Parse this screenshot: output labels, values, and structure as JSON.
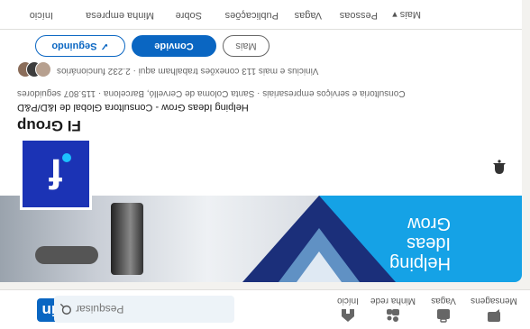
{
  "global_nav": {
    "logo": "in",
    "search_placeholder": "Pesquisar",
    "items": [
      {
        "label": "Início",
        "icon": "home-icon"
      },
      {
        "label": "Minha rede",
        "icon": "network-icon"
      },
      {
        "label": "Vagas",
        "icon": "briefcase-icon"
      },
      {
        "label": "Mensagens",
        "icon": "messaging-icon"
      }
    ]
  },
  "company": {
    "banner_tagline": [
      "Helping",
      "Ideas",
      "Grow"
    ],
    "logo_text": "f",
    "name": "FI Group",
    "tagline": "Helping Ideas Grow - Consultora Global de I&D/P&D",
    "meta": "Consultoria e serviços empresariais · Santa Coloma de Cervelló, Barcelona · 115.807 seguidores",
    "connections": "Vinicius e mais 113 conexões trabalham aqui · 2.232 funcionários",
    "buttons": {
      "following": "Seguindo",
      "invite": "Convide",
      "more": "Mais"
    },
    "tabs": [
      "Início",
      "Minha empresa",
      "Sobre",
      "Publicações",
      "Vagas",
      "Pessoas",
      "Mais"
    ]
  },
  "colors": {
    "linkedin_blue": "#0a66c2",
    "banner_blue": "#15a2e6",
    "logo_blue": "#1b33b5",
    "background": "#f3f2ef"
  }
}
